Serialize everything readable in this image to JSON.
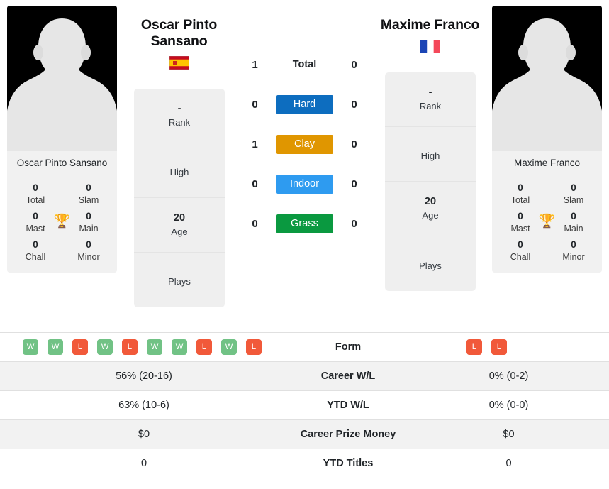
{
  "players": {
    "left": {
      "full_name": "Oscar Pinto Sansano",
      "card_name": "Oscar Pinto Sansano",
      "country_flag": "spain-flag",
      "rank": "-",
      "rank_label": "Rank",
      "high_value": "",
      "high_label": "High",
      "age": "20",
      "age_label": "Age",
      "plays_value": "",
      "plays_label": "Plays",
      "titles": {
        "total": "0",
        "total_label": "Total",
        "slam": "0",
        "slam_label": "Slam",
        "mast": "0",
        "mast_label": "Mast",
        "main": "0",
        "main_label": "Main",
        "chall": "0",
        "chall_label": "Chall",
        "minor": "0",
        "minor_label": "Minor"
      },
      "form": [
        "W",
        "W",
        "L",
        "W",
        "L",
        "W",
        "W",
        "L",
        "W",
        "L"
      ]
    },
    "right": {
      "full_name": "Maxime Franco",
      "card_name": "Maxime Franco",
      "country_flag": "france-flag",
      "rank": "-",
      "rank_label": "Rank",
      "high_value": "",
      "high_label": "High",
      "age": "20",
      "age_label": "Age",
      "plays_value": "",
      "plays_label": "Plays",
      "titles": {
        "total": "0",
        "total_label": "Total",
        "slam": "0",
        "slam_label": "Slam",
        "mast": "0",
        "mast_label": "Mast",
        "main": "0",
        "main_label": "Main",
        "chall": "0",
        "chall_label": "Chall",
        "minor": "0",
        "minor_label": "Minor"
      },
      "form": [
        "L",
        "L"
      ]
    }
  },
  "head_to_head": [
    {
      "label": "Total",
      "left": "1",
      "right": "0",
      "style": "plain",
      "color": ""
    },
    {
      "label": "Hard",
      "left": "0",
      "right": "0",
      "style": "badge",
      "color": "#0d6dbf"
    },
    {
      "label": "Clay",
      "left": "1",
      "right": "0",
      "style": "badge",
      "color": "#e09600"
    },
    {
      "label": "Indoor",
      "left": "0",
      "right": "0",
      "style": "badge",
      "color": "#2e9bf0"
    },
    {
      "label": "Grass",
      "left": "0",
      "right": "0",
      "style": "badge",
      "color": "#0a9940"
    }
  ],
  "comparison_rows": [
    {
      "label": "Form",
      "left": "",
      "right": ""
    },
    {
      "label": "Career W/L",
      "left": "56% (20-16)",
      "right": "0% (0-2)"
    },
    {
      "label": "YTD W/L",
      "left": "63% (10-6)",
      "right": "0% (0-0)"
    },
    {
      "label": "Career Prize Money",
      "left": "$0",
      "right": "$0"
    },
    {
      "label": "YTD Titles",
      "left": "0",
      "right": "0"
    }
  ],
  "icons": {
    "trophy": "🏆"
  },
  "colors": {
    "win_badge": "#71c285",
    "loss_badge": "#f1593a",
    "hard": "#0d6dbf",
    "clay": "#e09600",
    "indoor": "#2e9bf0",
    "grass": "#0a9940",
    "row_stripe": "#f2f2f2"
  }
}
